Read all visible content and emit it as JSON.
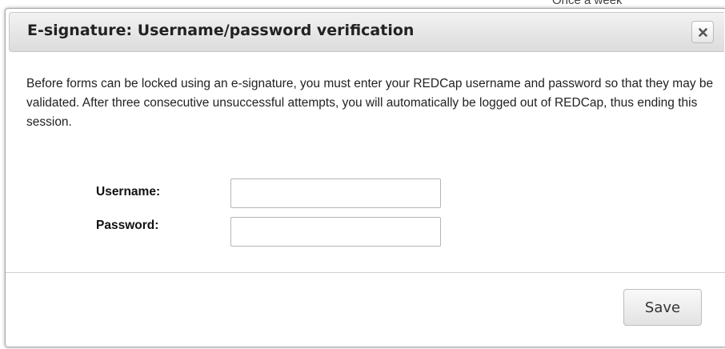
{
  "background": {
    "partial_text": "Once a week"
  },
  "dialog": {
    "title": "E-signature: Username/password verification",
    "close_icon": "close-x-icon",
    "message": "Before forms can be locked using an e-signature, you must enter your REDCap username and password so that they may be validated. After three consecutive unsuccessful attempts, you will automatically be logged out of REDCap, thus ending this session.",
    "username_label": "Username:",
    "username_value": "",
    "password_label": "Password:",
    "password_value": "",
    "save_label": "Save"
  },
  "colors": {
    "titlebar_top": "#f2f2f2",
    "titlebar_bottom": "#dcdcdc",
    "text": "#222222",
    "border": "#aaaaaa"
  }
}
